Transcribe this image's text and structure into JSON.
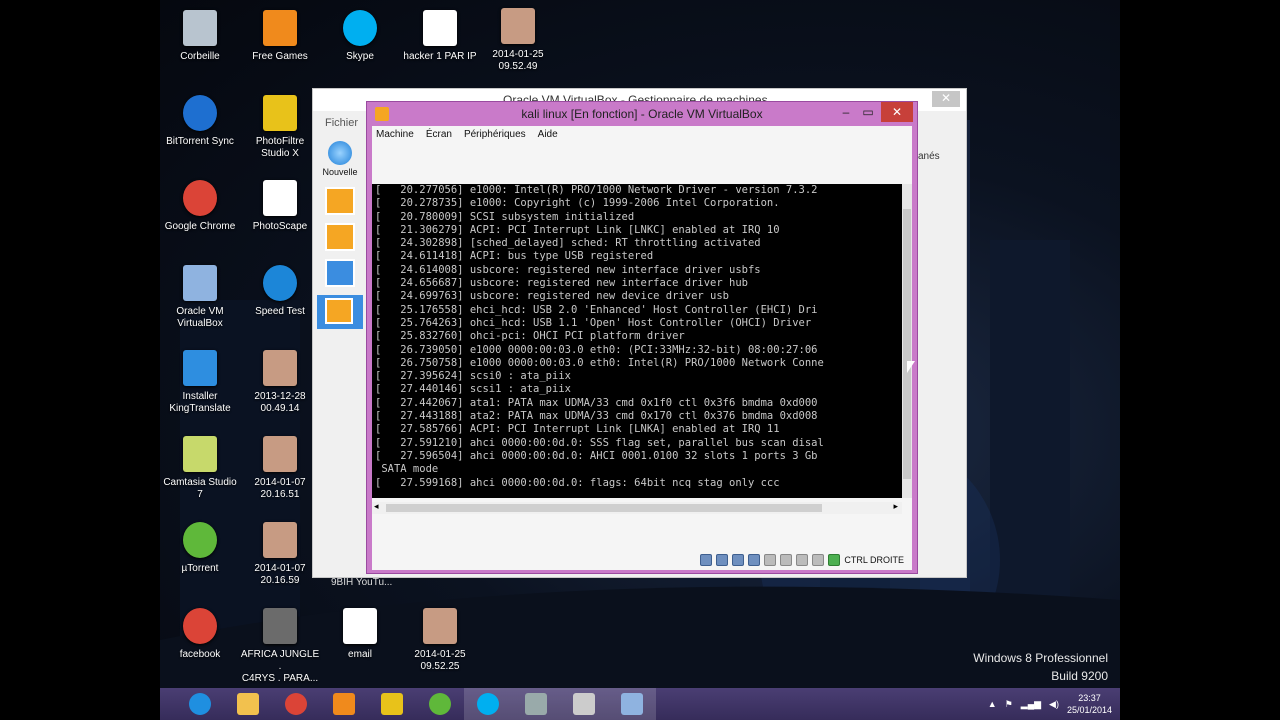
{
  "desktop": {
    "icons": [
      {
        "label": "Corbeille",
        "icon": "recycle-bin-icon"
      },
      {
        "label": "Free Games",
        "icon": "free-games-icon"
      },
      {
        "label": "Skype",
        "icon": "skype-icon"
      },
      {
        "label": "hacker 1 PAR IP",
        "icon": "document-icon"
      },
      {
        "label": "2014-01-25\n09.52.49",
        "icon": "photo-icon"
      },
      {
        "label": "BitTorrent Sync",
        "icon": "bittorrent-sync-icon"
      },
      {
        "label": "PhotoFiltre\nStudio X",
        "icon": "photofiltre-icon"
      },
      {
        "label": "Google Chrome",
        "icon": "chrome-icon"
      },
      {
        "label": "PhotoScape",
        "icon": "photoscape-icon"
      },
      {
        "label": "Oracle VM\nVirtualBox",
        "icon": "virtualbox-icon"
      },
      {
        "label": "Speed Test",
        "icon": "speed-test-icon"
      },
      {
        "label": "Installer\nKingTranslate",
        "icon": "kingtranslate-icon"
      },
      {
        "label": "2013-12-28\n00.49.14",
        "icon": "photo-icon"
      },
      {
        "label": "Camtasia Studio\n7",
        "icon": "camtasia-icon"
      },
      {
        "label": "2014-01-07\n20.16.51",
        "icon": "photo-icon"
      },
      {
        "label": "µTorrent",
        "icon": "utorrent-icon"
      },
      {
        "label": "2014-01-07\n20.16.59",
        "icon": "photo-icon"
      },
      {
        "label": "facebook",
        "icon": "chrome-icon"
      },
      {
        "label": "AFRICA JUNGLE .\nC4RYS . PARA...",
        "icon": "video-icon"
      },
      {
        "label": "email",
        "icon": "document-icon"
      },
      {
        "label": "2014-01-25\n09.52.25",
        "icon": "photo-icon"
      }
    ],
    "watermark": {
      "line1": "Windows 8 Professionnel",
      "line2": "Build 9200"
    }
  },
  "manager": {
    "title": "Oracle VM VirtualBox - Gestionnaire de machines",
    "menu_fichier": "Fichier",
    "nouvelle": "Nouvelle",
    "right_label": "anés",
    "bottom_label": "9BIH YouTu..."
  },
  "vm": {
    "title": "kali linux [En fonction] - Oracle VM VirtualBox",
    "menu": [
      "Machine",
      "Écran",
      "Périphériques",
      "Aide"
    ],
    "host_key": "CTRL DROITE",
    "console": "[   20.277056] e1000: Intel(R) PRO/1000 Network Driver - version 7.3.2\n[   20.278735] e1000: Copyright (c) 1999-2006 Intel Corporation.\n[   20.780009] SCSI subsystem initialized\n[   21.306279] ACPI: PCI Interrupt Link [LNKC] enabled at IRQ 10\n[   24.302898] [sched_delayed] sched: RT throttling activated\n[   24.611418] ACPI: bus type USB registered\n[   24.614008] usbcore: registered new interface driver usbfs\n[   24.656687] usbcore: registered new interface driver hub\n[   24.699763] usbcore: registered new device driver usb\n[   25.176558] ehci_hcd: USB 2.0 'Enhanced' Host Controller (EHCI) Dri\n[   25.764263] ohci_hcd: USB 1.1 'Open' Host Controller (OHCI) Driver\n[   25.832760] ohci-pci: OHCI PCI platform driver\n[   26.739050] e1000 0000:00:03.0 eth0: (PCI:33MHz:32-bit) 08:00:27:06\n[   26.750758] e1000 0000:00:03.0 eth0: Intel(R) PRO/1000 Network Conne\n[   27.395624] scsi0 : ata_piix\n[   27.440146] scsi1 : ata_piix\n[   27.442067] ata1: PATA max UDMA/33 cmd 0x1f0 ctl 0x3f6 bmdma 0xd000\n[   27.443188] ata2: PATA max UDMA/33 cmd 0x170 ctl 0x376 bmdma 0xd008\n[   27.585766] ACPI: PCI Interrupt Link [LNKA] enabled at IRQ 11\n[   27.591210] ahci 0000:00:0d.0: SSS flag set, parallel bus scan disal\n[   27.596504] ahci 0000:00:0d.0: AHCI 0001.0100 32 slots 1 ports 3 Gb\n SATA mode\n[   27.599168] ahci 0000:00:0d.0: flags: 64bit ncq stag only ccc\n_"
  },
  "taskbar": {
    "apps": [
      "ie-icon",
      "file-explorer-icon",
      "chrome-icon",
      "media-player-icon",
      "photofiltre-icon",
      "utorrent-icon",
      "skype-icon",
      "camtasia-icon",
      "recorder-icon",
      "virtualbox-icon"
    ],
    "time": "23:37",
    "date": "25/01/2014"
  }
}
